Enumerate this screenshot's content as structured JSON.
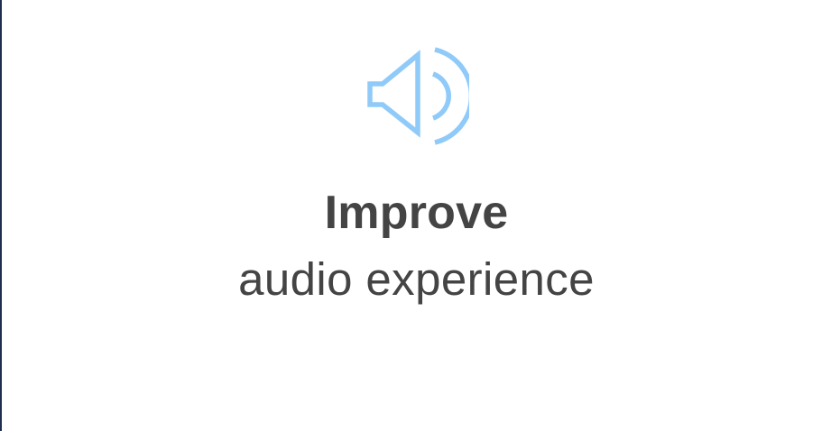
{
  "colors": {
    "icon": "#90caf9",
    "text": "#444444",
    "background": "#ffffff",
    "left_edge": "#1f2e4d"
  },
  "feature": {
    "icon": "speaker-volume-icon",
    "title": "Improve",
    "subtitle": "audio experience"
  }
}
